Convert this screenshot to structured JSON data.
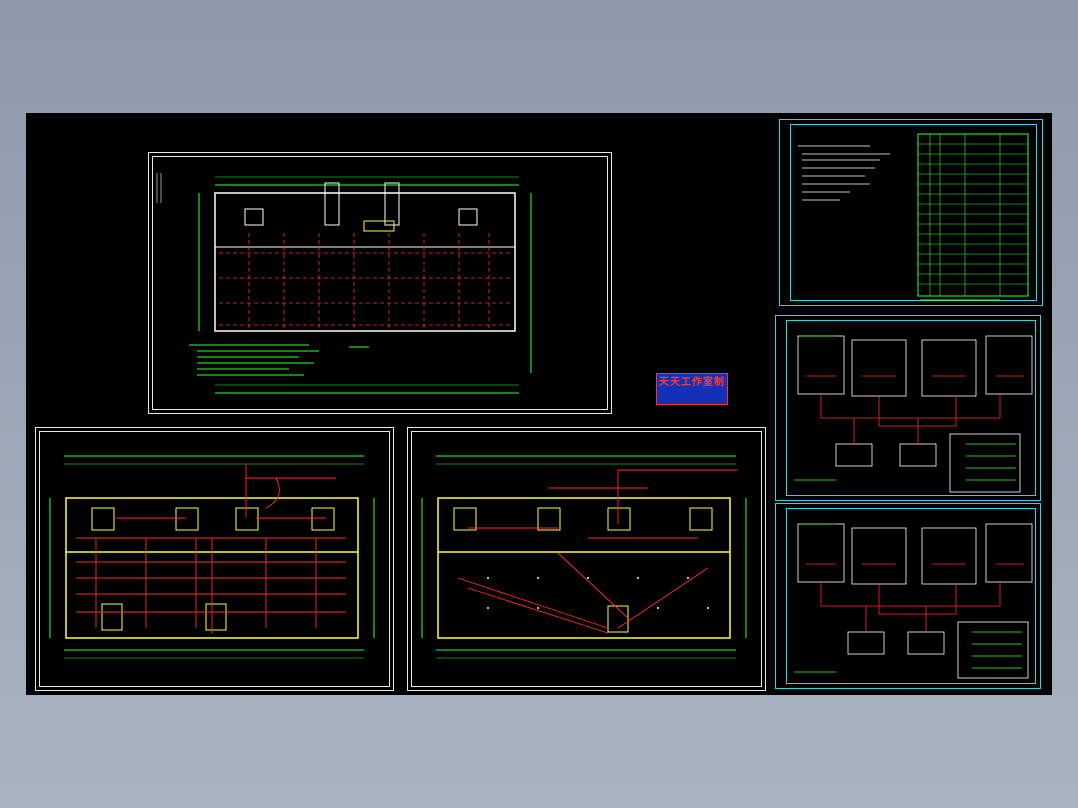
{
  "window": {
    "background": "#9aa5b5"
  },
  "viewport": {
    "background": "#000000"
  },
  "colors": {
    "sheet_frame": "#e8e8e8",
    "sheet_frame_cyan": "#27d7e6",
    "wall": "#ffff33",
    "circuit": "#ff2a2a",
    "dimension": "#33ff33",
    "outline": "#ffffff",
    "watermark_bg": "#1230b8"
  },
  "sheets": [
    {
      "id": "floor-plan-top",
      "kind": "floor-plan"
    },
    {
      "id": "lighting-plan-left",
      "kind": "electrical-plan"
    },
    {
      "id": "lighting-plan-middle",
      "kind": "electrical-plan"
    },
    {
      "id": "design-notes-table",
      "kind": "notes-and-table"
    },
    {
      "id": "distribution-diagram-1",
      "kind": "system-diagram"
    },
    {
      "id": "distribution-diagram-2",
      "kind": "system-diagram"
    }
  ],
  "watermark": {
    "title": "天天工作室制",
    "line1": "",
    "line2": ""
  }
}
